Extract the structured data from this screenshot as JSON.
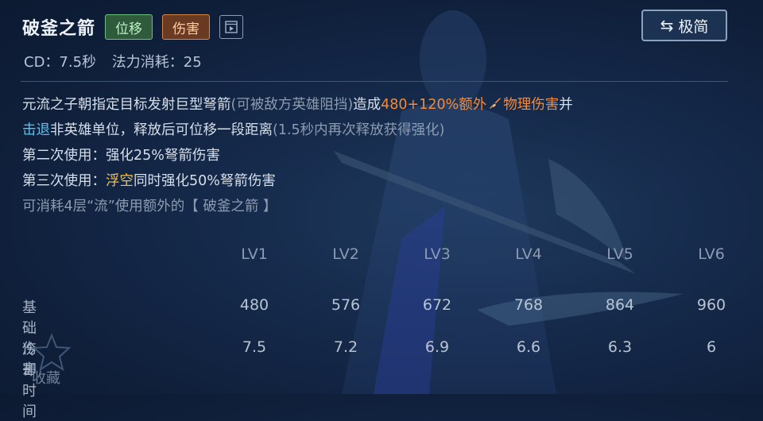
{
  "skill": {
    "name": "破釜之箭",
    "tags": [
      "位移",
      "伤害"
    ],
    "cd": "CD：7.5秒",
    "cost": "法力消耗：25"
  },
  "simple_button": {
    "label": "极简",
    "icon": "swap-arrows-icon"
  },
  "description": {
    "l1_a": "元流之子朝指定目标发射巨型弩箭",
    "l1_b": "(可被敌方英雄阻挡)",
    "l1_c": "造成",
    "l1_d": "480+120%额外",
    "l1_e": "物理伤害",
    "l1_f": "并",
    "l2_a": "击退",
    "l2_b": "非英雄单位，释放后可位移一段距离",
    "l2_c": "(1.5秒内再次释放获得强化)",
    "l3": "第二次使用：强化25%弩箭伤害",
    "l4_a": "第三次使用：",
    "l4_b": "浮空",
    "l4_c": "同时强化50%弩箭伤害",
    "l5": "可消耗4层“流”使用额外的【 破釜之箭 】"
  },
  "table": {
    "levels": [
      "LV1",
      "LV2",
      "LV3",
      "LV4",
      "LV5",
      "LV6"
    ],
    "rows": [
      {
        "label": "基础伤害",
        "values": [
          "480",
          "576",
          "672",
          "768",
          "864",
          "960"
        ]
      },
      {
        "label": "冷却时间",
        "values": [
          "7.5",
          "7.2",
          "6.9",
          "6.6",
          "6.3",
          "6"
        ]
      }
    ]
  },
  "favorite": {
    "label": "收藏"
  },
  "colors": {
    "orange": "#f28b3a",
    "blue": "#5bc3ee",
    "yellow": "#f3c04a"
  }
}
